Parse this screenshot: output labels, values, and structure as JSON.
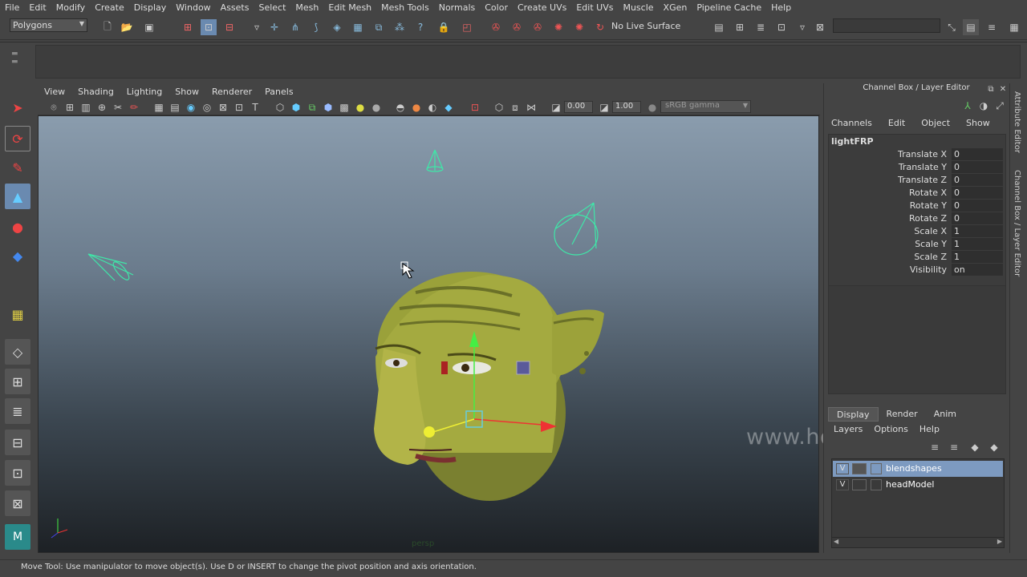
{
  "menubar": {
    "items": [
      "File",
      "Edit",
      "Modify",
      "Create",
      "Display",
      "Window",
      "Assets",
      "Select",
      "Mesh",
      "Edit Mesh",
      "Mesh Tools",
      "Normals",
      "Color",
      "Create UVs",
      "Edit UVs",
      "Muscle",
      "XGen",
      "Pipeline Cache",
      "Help"
    ]
  },
  "statusline": {
    "mode": "Polygons",
    "live_surface": "No Live Surface"
  },
  "panel": {
    "menu": [
      "View",
      "Shading",
      "Lighting",
      "Show",
      "Renderer",
      "Panels"
    ],
    "near_clip": "0.00",
    "far_clip": "1.00",
    "color_space": "sRGB gamma",
    "camera_label": "persp"
  },
  "watermark": "www.honaramiz.com",
  "channel_box": {
    "title": "Channel Box / Layer Editor",
    "menu": [
      "Channels",
      "Edit",
      "Object",
      "Show"
    ],
    "object_name": "lightFRP",
    "channels": [
      {
        "label": "Translate X",
        "value": "0"
      },
      {
        "label": "Translate Y",
        "value": "0"
      },
      {
        "label": "Translate Z",
        "value": "0"
      },
      {
        "label": "Rotate X",
        "value": "0"
      },
      {
        "label": "Rotate Y",
        "value": "0"
      },
      {
        "label": "Rotate Z",
        "value": "0"
      },
      {
        "label": "Scale X",
        "value": "1"
      },
      {
        "label": "Scale Y",
        "value": "1"
      },
      {
        "label": "Scale Z",
        "value": "1"
      },
      {
        "label": "Visibility",
        "value": "on"
      }
    ]
  },
  "side_tabs": [
    "Attribute Editor",
    "Channel Box / Layer Editor"
  ],
  "layer_editor": {
    "tabs": [
      "Display",
      "Render",
      "Anim"
    ],
    "active_tab": "Display",
    "menu": [
      "Layers",
      "Options",
      "Help"
    ],
    "layers": [
      {
        "visible": "V",
        "name": "blendshapes",
        "selected": true
      },
      {
        "visible": "V",
        "name": "headModel",
        "selected": false
      }
    ]
  },
  "help_line": "Move Tool: Use manipulator to move object(s). Use D or INSERT to change the pivot position and axis orientation.",
  "colors": {
    "ui_bg": "#444444",
    "selection": "#7d9ac0",
    "light_wire": "#3fe7a8",
    "skin": "#9aa13a"
  }
}
